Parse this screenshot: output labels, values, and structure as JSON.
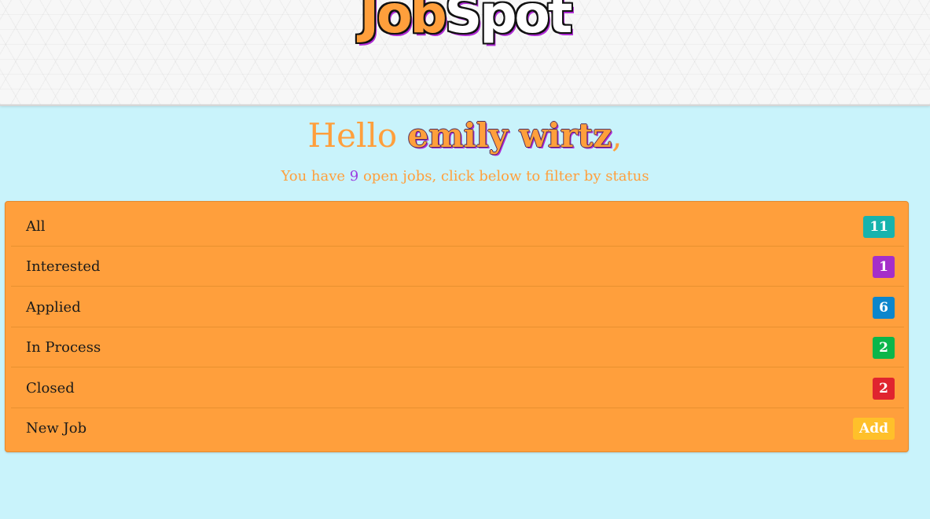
{
  "header": {
    "logo_part1": "Job",
    "logo_part2": "Spot"
  },
  "greeting": {
    "hello": "Hello ",
    "name": "emily wirtz",
    "comma": ","
  },
  "subtitle": {
    "prefix": "You have ",
    "open_count": "9",
    "suffix": " open jobs, click below to filter by status"
  },
  "status_list": [
    {
      "label": "All",
      "badge": "11",
      "color": "#17b3ad"
    },
    {
      "label": "Interested",
      "badge": "1",
      "color": "#a52ec9"
    },
    {
      "label": "Applied",
      "badge": "6",
      "color": "#0b86cc"
    },
    {
      "label": "In Process",
      "badge": "2",
      "color": "#0bb64a"
    },
    {
      "label": "Closed",
      "badge": "2",
      "color": "#e0242f"
    },
    {
      "label": "New Job",
      "badge": "Add",
      "color": "#ffc02a"
    }
  ],
  "colors": {
    "background": "#c9f3fb",
    "panel": "#ff9f3c",
    "accent_purple": "#9b3de0"
  }
}
